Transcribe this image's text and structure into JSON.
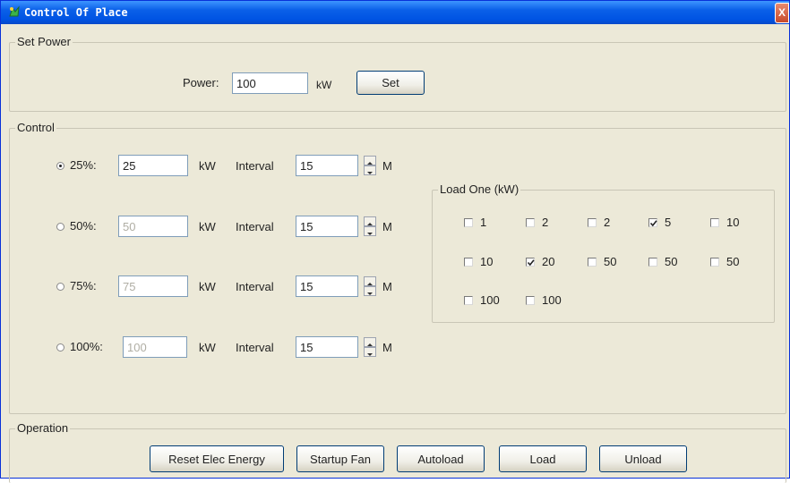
{
  "window": {
    "title": "Control Of Place",
    "close_label": "X"
  },
  "set_power": {
    "legend": "Set Power",
    "power_label": "Power:",
    "power_value": "100",
    "unit": "kW",
    "set_label": "Set"
  },
  "control": {
    "legend": "Control",
    "rows": [
      {
        "label": "25%:",
        "value": "25",
        "selected": true,
        "enabled": true,
        "unit": "kW",
        "interval_label": "Interval",
        "interval": "15",
        "interval_unit": "M"
      },
      {
        "label": "50%:",
        "value": "50",
        "selected": false,
        "enabled": false,
        "unit": "kW",
        "interval_label": "Interval",
        "interval": "15",
        "interval_unit": "M"
      },
      {
        "label": "75%:",
        "value": "75",
        "selected": false,
        "enabled": false,
        "unit": "kW",
        "interval_label": "Interval",
        "interval": "15",
        "interval_unit": "M"
      },
      {
        "label": "100%:",
        "value": "100",
        "selected": false,
        "enabled": false,
        "unit": "kW",
        "interval_label": "Interval",
        "interval": "15",
        "interval_unit": "M"
      }
    ],
    "load_one": {
      "legend": "Load One (kW)",
      "items": [
        {
          "label": "1",
          "checked": false
        },
        {
          "label": "2",
          "checked": false
        },
        {
          "label": "2",
          "checked": false
        },
        {
          "label": "5",
          "checked": true
        },
        {
          "label": "10",
          "checked": false
        },
        {
          "label": "10",
          "checked": false
        },
        {
          "label": "20",
          "checked": true
        },
        {
          "label": "50",
          "checked": false
        },
        {
          "label": "50",
          "checked": false
        },
        {
          "label": "50",
          "checked": false
        },
        {
          "label": "100",
          "checked": false
        },
        {
          "label": "100",
          "checked": false
        }
      ]
    }
  },
  "operation": {
    "legend": "Operation",
    "buttons": [
      "Reset Elec Energy",
      "Startup Fan",
      "Autoload",
      "Load",
      "Unload"
    ]
  }
}
